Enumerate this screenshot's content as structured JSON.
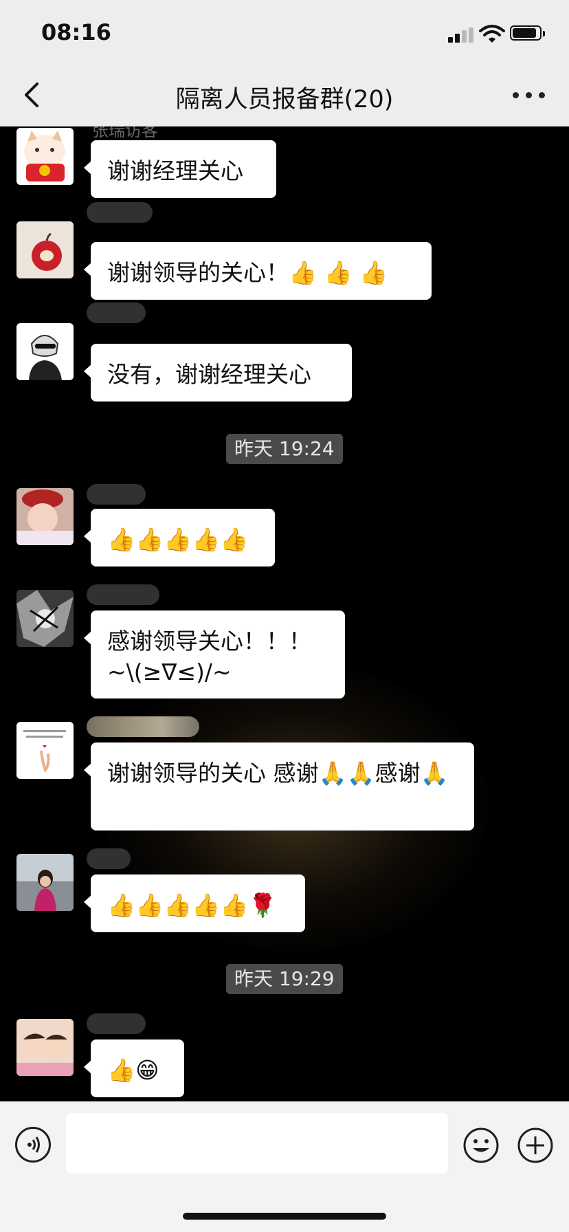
{
  "status_bar": {
    "time": "08:16"
  },
  "header": {
    "title": "隔离人员报备群(20)"
  },
  "chat": {
    "top_sender_partial": "张瑞访客",
    "messages": [
      {
        "text": "谢谢经理关心"
      },
      {
        "text": "谢谢领导的关心！👍 👍 👍"
      },
      {
        "text": "没有，谢谢经理关心"
      },
      {
        "text": "👍👍👍👍👍"
      },
      {
        "text": "感谢领导关心！！！\n~\\(≥∇≤)/~"
      },
      {
        "text": "谢谢领导的关心 感谢🙏🙏感谢🙏"
      },
      {
        "text": "👍👍👍👍👍🌹"
      },
      {
        "text": "👍😁"
      }
    ],
    "timestamps": [
      "昨天 19:24",
      "昨天 19:29"
    ]
  },
  "colors": {
    "chat_bg": "#000000",
    "bubble": "#ffffff",
    "bar_bg": "#ededed",
    "timestamp_bg": "#4a4a4a"
  }
}
